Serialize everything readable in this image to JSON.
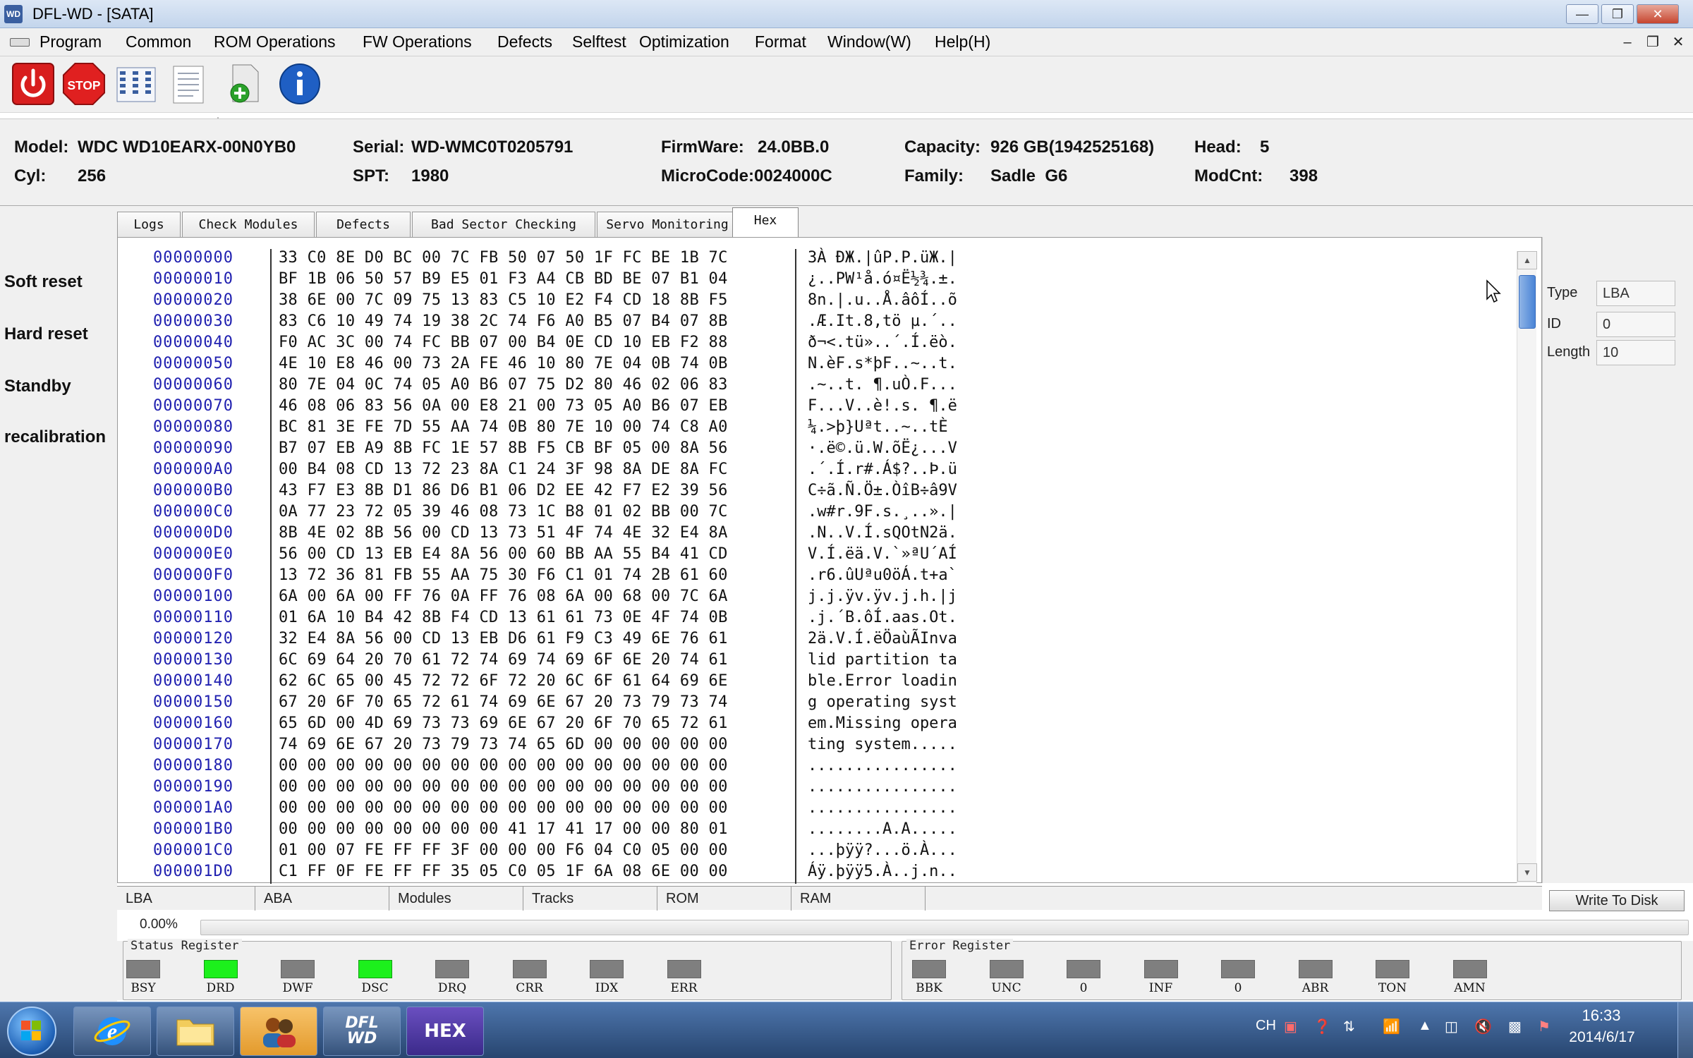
{
  "window": {
    "title": "DFL-WD - [SATA]",
    "icon_text": "WD"
  },
  "menu": [
    "Program",
    "Common",
    "ROM Operations",
    "FW Operations",
    "Defects",
    "Selftest",
    "Optimization",
    "Format",
    "Window(W)",
    "Help(H)"
  ],
  "toolbar": {
    "stop_label": "STOP",
    "buttons": [
      "power-icon",
      "stop-icon",
      "modules-list-icon",
      "document-icon",
      "add-file-icon",
      "info-icon"
    ]
  },
  "info": {
    "model_label": "Model:",
    "model": "WDC WD10EARX-00N0YB0",
    "serial_label": "Serial:",
    "serial": "WD-WMC0T0205791",
    "firmware_label": "FirmWare:",
    "firmware": "24.0BB.0",
    "capacity_label": "Capacity:",
    "capacity": "926 GB(1942525168)",
    "head_label": "Head:",
    "head": "5",
    "cyl_label": "Cyl:",
    "cyl": "256",
    "spt_label": "SPT:",
    "spt": "1980",
    "microcode": "MicroCode:0024000C",
    "family_label": "Family:",
    "family": "Sadle  G6",
    "modcnt_label": "ModCnt:",
    "modcnt": "398"
  },
  "actions": [
    "Soft reset",
    "Hard reset",
    "Standby",
    "recalibration"
  ],
  "tabs": [
    "Logs",
    "Check Modules",
    "Defects",
    "Bad Sector Checking",
    "Servo Monitoring",
    "Hex"
  ],
  "active_tab": "Hex",
  "hex": [
    {
      "addr": "00000000",
      "bytes": "33 C0 8E D0 BC 00 7C FB 50 07 50 1F FC BE 1B 7C",
      "ascii": "3À ÐЖ.|ûP.P.üЖ.|"
    },
    {
      "addr": "00000010",
      "bytes": "BF 1B 06 50 57 B9 E5 01 F3 A4 CB BD BE 07 B1 04",
      "ascii": "¿..PW¹å.ó¤Ë½¾.±."
    },
    {
      "addr": "00000020",
      "bytes": "38 6E 00 7C 09 75 13 83 C5 10 E2 F4 CD 18 8B F5",
      "ascii": "8n.|.u..Å.âôÍ..õ"
    },
    {
      "addr": "00000030",
      "bytes": "83 C6 10 49 74 19 38 2C 74 F6 A0 B5 07 B4 07 8B",
      "ascii": ".Æ.It.8,tö µ.´.."
    },
    {
      "addr": "00000040",
      "bytes": "F0 AC 3C 00 74 FC BB 07 00 B4 0E CD 10 EB F2 88",
      "ascii": "ð¬<.tü»..´.Í.ëò."
    },
    {
      "addr": "00000050",
      "bytes": "4E 10 E8 46 00 73 2A FE 46 10 80 7E 04 0B 74 0B",
      "ascii": "N.èF.s*þF..~..t."
    },
    {
      "addr": "00000060",
      "bytes": "80 7E 04 0C 74 05 A0 B6 07 75 D2 80 46 02 06 83",
      "ascii": ".~..t. ¶.uÒ.F..."
    },
    {
      "addr": "00000070",
      "bytes": "46 08 06 83 56 0A 00 E8 21 00 73 05 A0 B6 07 EB",
      "ascii": "F...V..è!.s. ¶.ë"
    },
    {
      "addr": "00000080",
      "bytes": "BC 81 3E FE 7D 55 AA 74 0B 80 7E 10 00 74 C8 A0",
      "ascii": "¼.>þ}Uªt..~..tÈ "
    },
    {
      "addr": "00000090",
      "bytes": "B7 07 EB A9 8B FC 1E 57 8B F5 CB BF 05 00 8A 56",
      "ascii": "·.ë©.ü.W.õË¿...V"
    },
    {
      "addr": "000000A0",
      "bytes": "00 B4 08 CD 13 72 23 8A C1 24 3F 98 8A DE 8A FC",
      "ascii": ".´.Í.r#.Á$?..Þ.ü"
    },
    {
      "addr": "000000B0",
      "bytes": "43 F7 E3 8B D1 86 D6 B1 06 D2 EE 42 F7 E2 39 56",
      "ascii": "C÷ã.Ñ.Ö±.ÒîB÷â9V"
    },
    {
      "addr": "000000C0",
      "bytes": "0A 77 23 72 05 39 46 08 73 1C B8 01 02 BB 00 7C",
      "ascii": ".w#r.9F.s.¸..».|"
    },
    {
      "addr": "000000D0",
      "bytes": "8B 4E 02 8B 56 00 CD 13 73 51 4F 74 4E 32 E4 8A",
      "ascii": ".N..V.Í.sQOtN2ä."
    },
    {
      "addr": "000000E0",
      "bytes": "56 00 CD 13 EB E4 8A 56 00 60 BB AA 55 B4 41 CD",
      "ascii": "V.Í.ëä.V.`»ªU´AÍ"
    },
    {
      "addr": "000000F0",
      "bytes": "13 72 36 81 FB 55 AA 75 30 F6 C1 01 74 2B 61 60",
      "ascii": ".r6.ûUªu0öÁ.t+a`"
    },
    {
      "addr": "00000100",
      "bytes": "6A 00 6A 00 FF 76 0A FF 76 08 6A 00 68 00 7C 6A",
      "ascii": "j.j.ÿv.ÿv.j.h.|j"
    },
    {
      "addr": "00000110",
      "bytes": "01 6A 10 B4 42 8B F4 CD 13 61 61 73 0E 4F 74 0B",
      "ascii": ".j.´B.ôÍ.aas.Ot."
    },
    {
      "addr": "00000120",
      "bytes": "32 E4 8A 56 00 CD 13 EB D6 61 F9 C3 49 6E 76 61",
      "ascii": "2ä.V.Í.ëÖaùÃInva"
    },
    {
      "addr": "00000130",
      "bytes": "6C 69 64 20 70 61 72 74 69 74 69 6F 6E 20 74 61",
      "ascii": "lid partition ta"
    },
    {
      "addr": "00000140",
      "bytes": "62 6C 65 00 45 72 72 6F 72 20 6C 6F 61 64 69 6E",
      "ascii": "ble.Error loadin"
    },
    {
      "addr": "00000150",
      "bytes": "67 20 6F 70 65 72 61 74 69 6E 67 20 73 79 73 74",
      "ascii": "g operating syst"
    },
    {
      "addr": "00000160",
      "bytes": "65 6D 00 4D 69 73 73 69 6E 67 20 6F 70 65 72 61",
      "ascii": "em.Missing opera"
    },
    {
      "addr": "00000170",
      "bytes": "74 69 6E 67 20 73 79 73 74 65 6D 00 00 00 00 00",
      "ascii": "ting system....."
    },
    {
      "addr": "00000180",
      "bytes": "00 00 00 00 00 00 00 00 00 00 00 00 00 00 00 00",
      "ascii": "................"
    },
    {
      "addr": "00000190",
      "bytes": "00 00 00 00 00 00 00 00 00 00 00 00 00 00 00 00",
      "ascii": "................"
    },
    {
      "addr": "000001A0",
      "bytes": "00 00 00 00 00 00 00 00 00 00 00 00 00 00 00 00",
      "ascii": "................"
    },
    {
      "addr": "000001B0",
      "bytes": "00 00 00 00 00 00 00 00 41 17 41 17 00 00 80 01",
      "ascii": "........A.A....."
    },
    {
      "addr": "000001C0",
      "bytes": "01 00 07 FE FF FF 3F 00 00 00 F6 04 C0 05 00 00",
      "ascii": "...þÿÿ?...ö.À..."
    },
    {
      "addr": "000001D0",
      "bytes": "C1 FF 0F FE FF FF 35 05 C0 05 1F 6A 08 6E 00 00",
      "ascii": "Áÿ.þÿÿ5.À..j.n.."
    }
  ],
  "right_panel": {
    "type_label": "Type",
    "type_value": "LBA",
    "id_label": "ID",
    "id_value": "0",
    "length_label": "Length",
    "length_value": "10"
  },
  "write_button": "Write To Disk",
  "modes": [
    "LBA",
    "ABA",
    "Modules",
    "Tracks",
    "ROM",
    "RAM"
  ],
  "progress": {
    "label": "0.00%",
    "value": 0
  },
  "status_register": {
    "title": "Status Register",
    "bits": [
      {
        "label": "BSY",
        "on": false
      },
      {
        "label": "DRD",
        "on": true
      },
      {
        "label": "DWF",
        "on": false
      },
      {
        "label": "DSC",
        "on": true
      },
      {
        "label": "DRQ",
        "on": false
      },
      {
        "label": "CRR",
        "on": false
      },
      {
        "label": "IDX",
        "on": false
      },
      {
        "label": "ERR",
        "on": false
      }
    ]
  },
  "error_register": {
    "title": "Error Register",
    "bits": [
      {
        "label": "BBK",
        "on": false
      },
      {
        "label": "UNC",
        "on": false
      },
      {
        "label": "0",
        "on": false
      },
      {
        "label": "INF",
        "on": false
      },
      {
        "label": "0",
        "on": false
      },
      {
        "label": "ABR",
        "on": false
      },
      {
        "label": "TON",
        "on": false
      },
      {
        "label": "AMN",
        "on": false
      }
    ]
  },
  "taskbar": {
    "apps": [
      "internet-explorer-icon",
      "folder-icon",
      "users-icon",
      "dfl-wd-icon",
      "hex-editor-icon"
    ],
    "dfl_text": "DFL WD",
    "hex_text": "HEX",
    "lang": "CH",
    "time": "16:33",
    "date": "2014/6/17"
  },
  "colors": {
    "led_on": "#1cf01c",
    "led_off": "#7f7f7f",
    "address": "#2020b0",
    "accent": "#4a84d6"
  }
}
